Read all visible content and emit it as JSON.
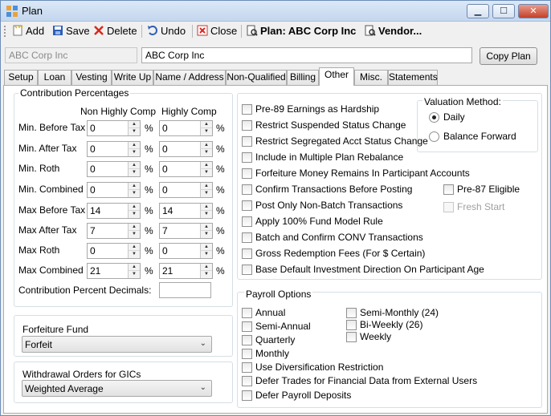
{
  "window": {
    "title": "Plan",
    "controls": {
      "minimize": "▁",
      "maximize": "☐",
      "close": "✕"
    }
  },
  "toolbar": {
    "add": "Add",
    "save": "Save",
    "delete": "Delete",
    "undo": "Undo",
    "close": "Close",
    "plan": "Plan: ABC Corp Inc",
    "vendor": "Vendor..."
  },
  "header": {
    "plan_code": "ABC Corp Inc",
    "plan_name": "ABC Corp Inc",
    "copy_plan": "Copy Plan"
  },
  "tabs": [
    "Setup",
    "Loan",
    "Vesting",
    "Write Up",
    "Name / Address",
    "Non-Qualified",
    "Billing",
    "Other",
    "Misc.",
    "Statements"
  ],
  "active_tab": "Other",
  "contribution": {
    "title": "Contribution Percentages",
    "col_non_highly": "Non Highly Comp",
    "col_highly": "Highly Comp",
    "percent_symbol": "%",
    "rows": [
      {
        "label": "Min. Before Tax",
        "non_highly": "0",
        "highly": "0"
      },
      {
        "label": "Min. After Tax",
        "non_highly": "0",
        "highly": "0"
      },
      {
        "label": "Min. Roth",
        "non_highly": "0",
        "highly": "0"
      },
      {
        "label": "Min. Combined",
        "non_highly": "0",
        "highly": "0"
      },
      {
        "label": "Max Before Tax",
        "non_highly": "14",
        "highly": "14"
      },
      {
        "label": "Max After Tax",
        "non_highly": "7",
        "highly": "7"
      },
      {
        "label": "Max Roth",
        "non_highly": "0",
        "highly": "0"
      },
      {
        "label": "Max Combined",
        "non_highly": "21",
        "highly": "21"
      }
    ],
    "decimals_label": "Contribution Percent Decimals:",
    "decimals_value": ""
  },
  "forfeiture": {
    "title": "Forfeiture Fund",
    "value": "Forfeit"
  },
  "withdrawal": {
    "title": "Withdrawal Orders for GICs",
    "value": "Weighted Average"
  },
  "options": [
    {
      "label": "Pre-89 Earnings as Hardship",
      "checked": false
    },
    {
      "label": "Restrict Suspended Status Change",
      "checked": false
    },
    {
      "label": "Restrict Segregated Acct Status Change",
      "checked": false
    },
    {
      "label": "Include in Multiple Plan Rebalance",
      "checked": false
    },
    {
      "label": "Forfeiture Money Remains In Participant Accounts",
      "checked": false
    },
    {
      "label": "Confirm Transactions Before Posting",
      "checked": false
    },
    {
      "label": "Post Only Non-Batch Transactions",
      "checked": false
    },
    {
      "label": "Apply 100% Fund Model Rule",
      "checked": false
    },
    {
      "label": "Batch and Confirm CONV Transactions",
      "checked": false
    },
    {
      "label": "Gross Redemption Fees (For $ Certain)",
      "checked": false
    },
    {
      "label": "Base Default Investment Direction On Participant Age",
      "checked": false
    }
  ],
  "pre87": {
    "label": "Pre-87 Eligible",
    "checked": false
  },
  "fresh_start": {
    "label": "Fresh Start",
    "checked": false
  },
  "valuation": {
    "title": "Valuation Method:",
    "options": [
      {
        "label": "Daily",
        "selected": true
      },
      {
        "label": "Balance Forward",
        "selected": false
      }
    ]
  },
  "payroll": {
    "title": "Payroll Options",
    "left": [
      {
        "label": "Annual",
        "checked": false
      },
      {
        "label": "Semi-Annual",
        "checked": false
      },
      {
        "label": "Quarterly",
        "checked": false
      },
      {
        "label": "Monthly",
        "checked": false
      }
    ],
    "right": [
      {
        "label": "Semi-Monthly (24)",
        "checked": false
      },
      {
        "label": "Bi-Weekly (26)",
        "checked": false
      },
      {
        "label": "Weekly",
        "checked": false
      }
    ],
    "bottom": [
      {
        "label": "Use Diversification Restriction",
        "checked": false
      },
      {
        "label": "Defer Trades for Financial Data from External Users",
        "checked": false
      },
      {
        "label": "Defer Payroll Deposits",
        "checked": false
      }
    ]
  }
}
